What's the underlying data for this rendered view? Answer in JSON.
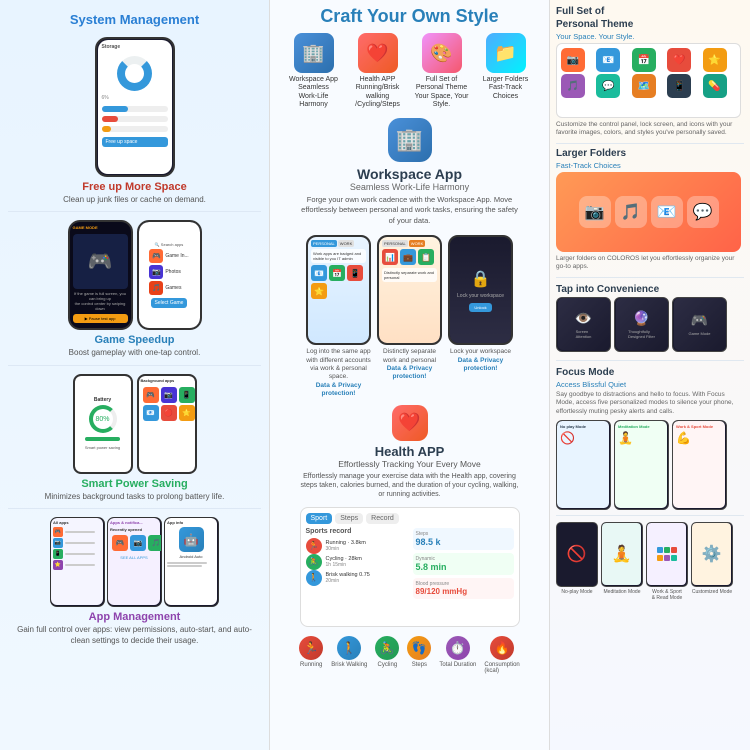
{
  "page": {
    "title": "System Management"
  },
  "left": {
    "section_title": "System Management",
    "features": [
      {
        "id": "storage",
        "title": "Free up More Space",
        "title_color": "#c0392b",
        "desc": "Clean up junk files or cache on demand."
      },
      {
        "id": "game",
        "title": "Game Speedup",
        "title_color": "#2980b9",
        "desc": "Boost gameplay with one-tap control."
      },
      {
        "id": "power",
        "title": "Smart Power Saving",
        "title_color": "#27ae60",
        "desc": "Minimizes background tasks to prolong battery life."
      },
      {
        "id": "apps",
        "title": "App Management",
        "title_color": "#8e44ad",
        "desc": "Gain full control over apps: view permissions, auto-start, and auto-clean settings to decide their usage."
      }
    ]
  },
  "middle": {
    "craft_title": "Craft Your Own Style",
    "style_options": [
      {
        "id": "health",
        "label": "Health APP\nRunning/Brisk walking /Cycling/Steps",
        "icon": "💊"
      },
      {
        "id": "personal",
        "label": "Full Set of Personal Theme\nYour Space, Your Style.",
        "icon": "🎨"
      },
      {
        "id": "folders",
        "label": "Larger Folders\nFast-Track Choices",
        "icon": "📁"
      }
    ],
    "workspace": {
      "label": "Workspace App",
      "subtitle": "Seamless Work-Life Harmony",
      "desc": "Forge your own work cadence with the Workspace App. Move effortlessly between personal and work tasks, ensuring the safety of your data.",
      "icon": "🏢",
      "phones": [
        {
          "id": "personal",
          "label": "Log into the same app with different accounts via work & personal space.",
          "label_highlight": "Data & Privacy protection!"
        },
        {
          "id": "work",
          "label": "Distinctly separate work and personal",
          "label_highlight": "Data & Privacy protection!"
        },
        {
          "id": "lock",
          "label": "Lock your workspace",
          "label_highlight": "Data & Privacy protection!"
        }
      ]
    },
    "health": {
      "label": "Health APP",
      "subtitle": "Effortlessly Tracking Your Every Move",
      "desc": "Effortlessly manage your exercise data with the Health app, covering steps taken, calories burned, and the duration of your cycling, walking, or running activities.",
      "icon": "❤️",
      "tabs": [
        "Sport",
        "Steps",
        "Record"
      ],
      "records": [
        {
          "type": "running",
          "desc": "Running · 3.8km"
        },
        {
          "type": "cycling",
          "desc": "Cycling · 28km"
        },
        {
          "type": "walking",
          "desc": "Brisk walking 0.75"
        }
      ],
      "activity_icons": [
        "🏃",
        "🚶",
        "🚴",
        "👣",
        "⏱️",
        "🔥"
      ],
      "activity_labels": [
        "Running",
        "Brisk Walking",
        "Cycling",
        "Steps",
        "Total Duration",
        "Consumption (kcal)"
      ]
    }
  },
  "right": {
    "sections": [
      {
        "id": "personal-theme",
        "title": "Full Set of Personal Theme",
        "subtitle": "Your Space. Your Style.",
        "desc": "Customize the control panel, lock screen, and icons with your favorite images, colors, and styles you've personally saved."
      },
      {
        "id": "larger-folders",
        "title": "Larger Folders",
        "subtitle": "Fast-Track Choices",
        "desc": "Larger folders on COLOROS let you effortlessly organize your go-to apps."
      },
      {
        "id": "tap-convenience",
        "title": "Tap into Convenience",
        "phones": [
          {
            "label": "Screen Attention"
          },
          {
            "label": "Thoughtfully Designed Filter"
          },
          {
            "label": "Game Mode"
          }
        ]
      },
      {
        "id": "focus-mode",
        "title": "Focus Mode",
        "subtitle": "Access Blissful Quiet",
        "desc": "Say goodbye to distractions and hello to focus. With Focus Mode, access five personalized modes to silence your phone, effortlessly muting pesky alerts and calls.",
        "mode_labels": [
          "No-play Mode",
          "Meditation Mode",
          "Work & Sport & Read Mode",
          "Customized Mode"
        ]
      }
    ]
  }
}
